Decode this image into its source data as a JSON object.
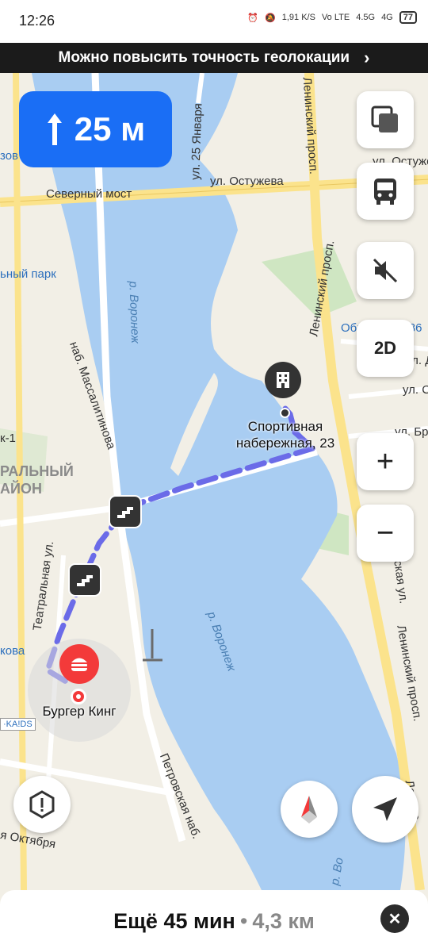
{
  "status_bar": {
    "time": "12:26",
    "net_speed": "1,91",
    "net_unit": "K/S",
    "volte": "Vo LTE",
    "signal1": "4.5G",
    "signal2": "4G",
    "battery": "77"
  },
  "geo_banner": {
    "text": "Можно повысить точность геолокации"
  },
  "navigation": {
    "distance": "25 м",
    "direction_icon": "arrow-up-icon"
  },
  "map": {
    "labels": {
      "ostuzheva_top": "ул. Остуже",
      "severny_most": "Северный мост",
      "ostuzheva": "ул. Остужева",
      "yanvarya25": "ул. 25 Января",
      "leninsky_top": "Ленинский просп.",
      "leninsky_mid": "Ленинский просп.",
      "leninsky_bottom": "Ленинский просп.",
      "leninsky_corner": "Ленинс",
      "park": "ьный парк",
      "zov": "зов",
      "voronezh_upper": "р. Воронеж",
      "voronezh_lower": "р. Воронеж",
      "voronezh_bottom": "р. Во",
      "massalitinova": "наб. Массалитинова",
      "obruchevа": "Обручева (586",
      "ul_d": "ул. Д",
      "ul_s": "ул. С",
      "ul_bru": "ул. Брус",
      "district1": "РАЛЬНЫЙ",
      "district2": "АЙОН",
      "k1": "к-1",
      "teatralnaya": "Театральная ул.",
      "kova": "кова",
      "petrovskaya": "Петровская наб.",
      "oktyabrya": "я Октября",
      "leninskaya_ul": "ская ул.",
      "kaids": "·KA!DS"
    },
    "poi_destination": "Спортивная набережная, 23",
    "poi_start": "Бургер Кинг"
  },
  "controls": {
    "layers_icon": "layers-icon",
    "transport_icon": "bus-icon",
    "sound_icon": "sound-off-icon",
    "view_mode": "2D",
    "zoom_in": "+",
    "zoom_out": "−",
    "report_icon": "warning-shield-icon",
    "compass_icon": "compass-icon",
    "locate_icon": "locate-arrow-icon"
  },
  "bottom_panel": {
    "eta": "Ещё 45 мин",
    "separator": "•",
    "distance": "4,3 км",
    "close": "✕"
  },
  "colors": {
    "water": "#a9cdf2",
    "route": "#6b6be8",
    "nav_blue": "#1a6ef5",
    "poi_red": "#f33a3a",
    "road_yellow": "#fbe38c"
  }
}
